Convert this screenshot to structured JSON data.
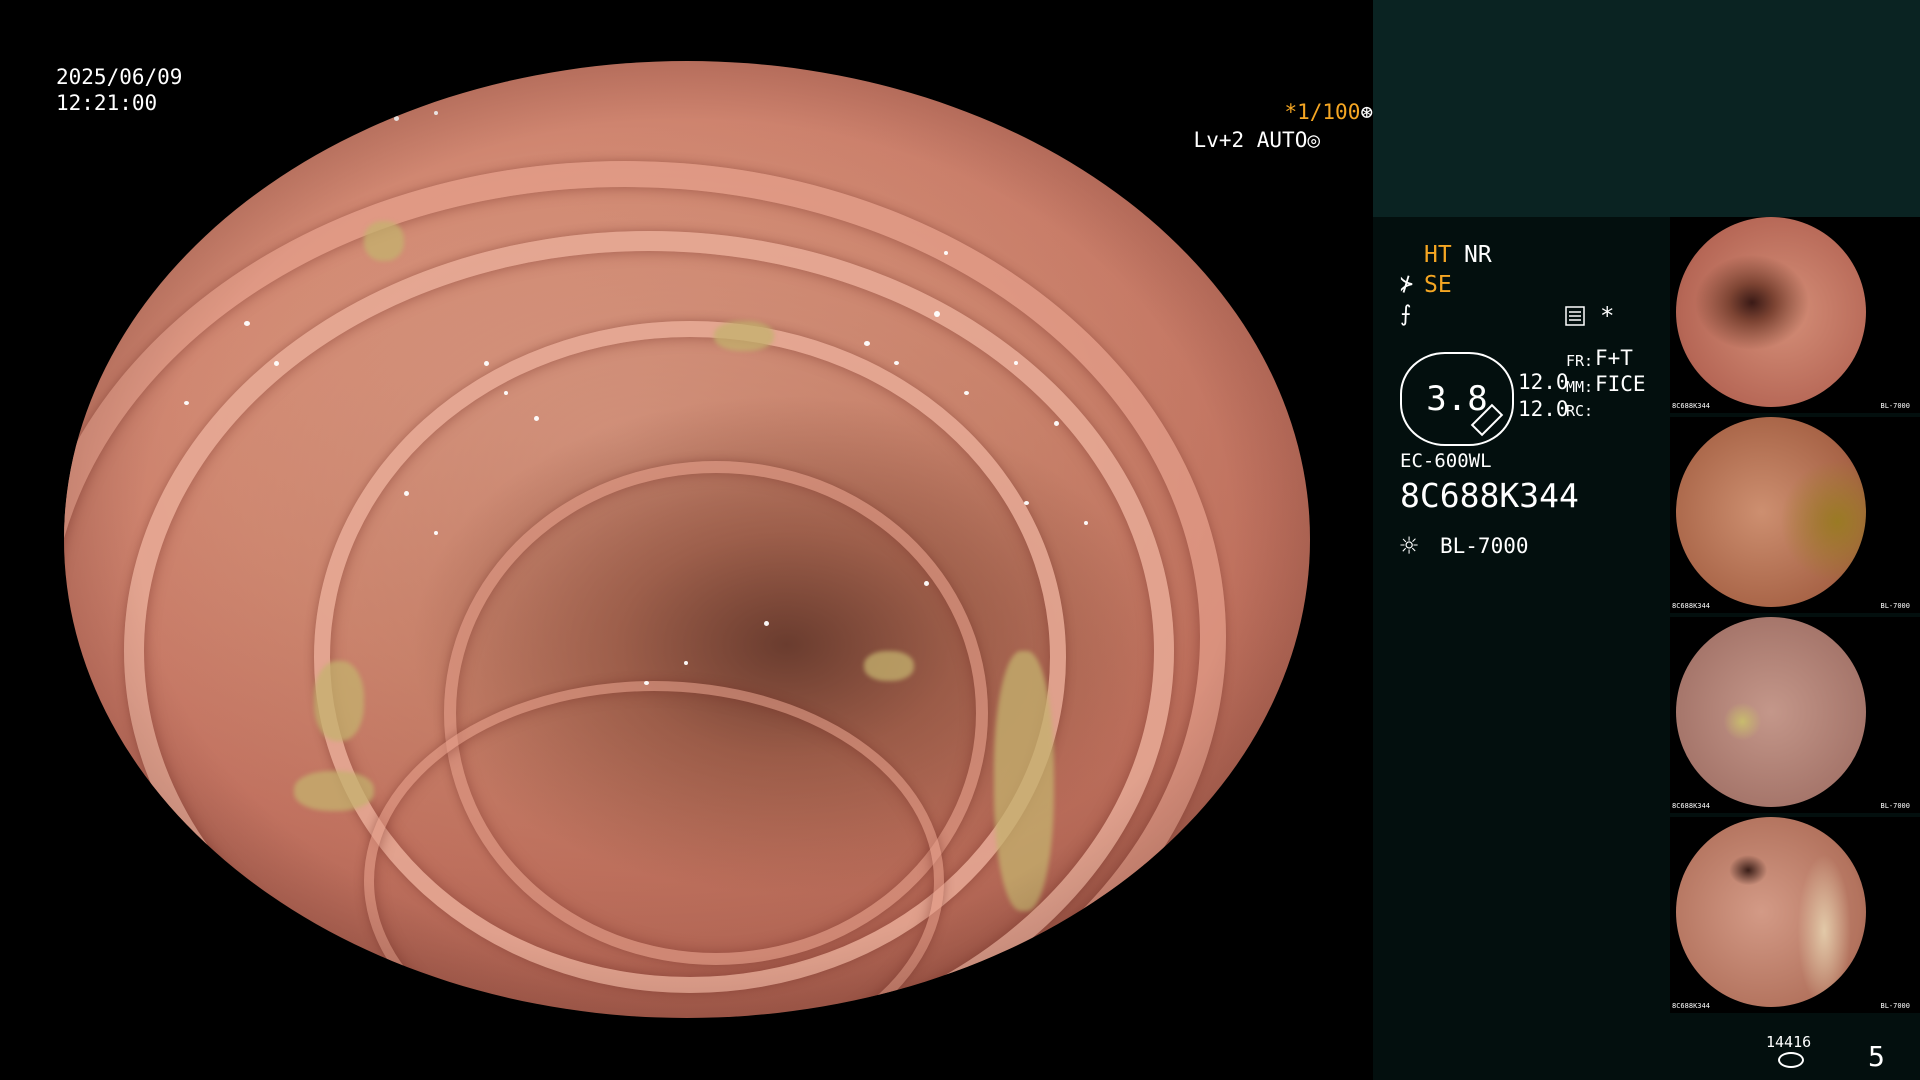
{
  "overlay": {
    "date": "2025/06/09",
    "time": "12:21:00",
    "shutter": "*1/100",
    "level": "Lv+2 AUTO"
  },
  "info": {
    "ht": "HT",
    "nr": "NR",
    "se": "SE",
    "zoom_value": "3.8",
    "ratio_1": "12.0",
    "ratio_2": "12.0",
    "fr_label": "FR:",
    "fr_value": "F+T",
    "mm_label": "MM:",
    "mm_value": "FICE",
    "rc_label": "RC:",
    "scope_model": "EC-600WL",
    "scope_serial": "8C688K344",
    "light_source": "BL-7000"
  },
  "thumbnails": [
    {
      "serial": "8C688K344",
      "light": "BL-7000"
    },
    {
      "serial": "8C688K344",
      "light": "BL-7000"
    },
    {
      "serial": "8C688K344",
      "light": "BL-7000"
    },
    {
      "serial": "8C688K344",
      "light": "BL-7000"
    }
  ],
  "footer": {
    "image_count": "14416",
    "page_number": "5"
  },
  "colors": {
    "accent_orange": "#f5a623",
    "panel_top": "#0a2322",
    "panel_bottom": "#030f0e"
  },
  "icons": {
    "se_icon": "scope-se-icon",
    "f_icon": "f-curve-icon",
    "menu_icon": "menu-icon",
    "star_icon": "asterisk-icon",
    "light_icon": "light-bulb-icon",
    "shutter_icon": "aperture-icon",
    "level_icon": "auto-iris-icon",
    "storage_icon": "storage-icon"
  }
}
